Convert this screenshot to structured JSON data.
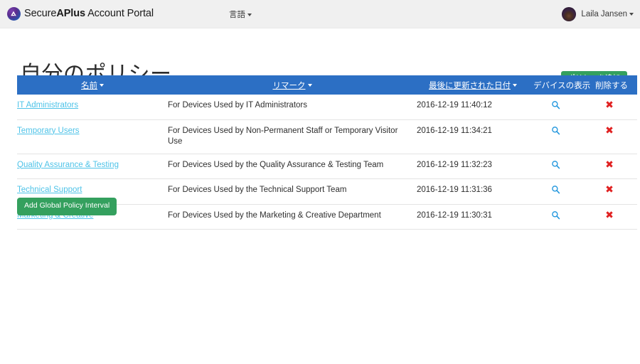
{
  "navbar": {
    "brand_prefix": "Secure",
    "brand_bold": "APlus",
    "brand_suffix": " Account Portal",
    "language_label": "言語",
    "user_name": "Laila Jansen"
  },
  "page": {
    "title": "自分のポリシー",
    "add_policy_label": "ポリシーを追加",
    "add_global_interval_label": "Add Global Policy Interval"
  },
  "table": {
    "headers": {
      "name": "名前",
      "remark": "リマーク",
      "last_updated": "最後に更新された日付",
      "view_devices": "デバイスの表示",
      "delete": "削除する"
    },
    "rows": [
      {
        "name": "IT Administrators",
        "remark": "For Devices Used by IT Administrators",
        "last_updated": "2016-12-19 11:40:12"
      },
      {
        "name": "Temporary Users",
        "remark": "For Devices Used by Non-Permanent Staff or Temporary Visitor Use",
        "last_updated": "2016-12-19 11:34:21"
      },
      {
        "name": "Quality Assurance & Testing",
        "remark": "For Devices Used by the Quality Assurance & Testing Team",
        "last_updated": "2016-12-19 11:32:23"
      },
      {
        "name": "Technical Support",
        "remark": "For Devices Used by the Technical Support Team",
        "last_updated": "2016-12-19 11:31:36"
      },
      {
        "name": "Marketing & Creative",
        "remark": "For Devices Used by the Marketing & Creative Department",
        "last_updated": "2016-12-19 11:30:31"
      }
    ],
    "icons": {
      "view": "magnifier-icon",
      "delete": "x-mark-icon",
      "delete_glyph": "✖"
    }
  },
  "colors": {
    "navbar_bg": "#f0f0f0",
    "table_header_bg": "#2c6fc4",
    "green_button": "#34a05e",
    "link_blue": "#4ec3e8",
    "delete_red": "#e02020",
    "view_icon_blue": "#2196dd"
  }
}
